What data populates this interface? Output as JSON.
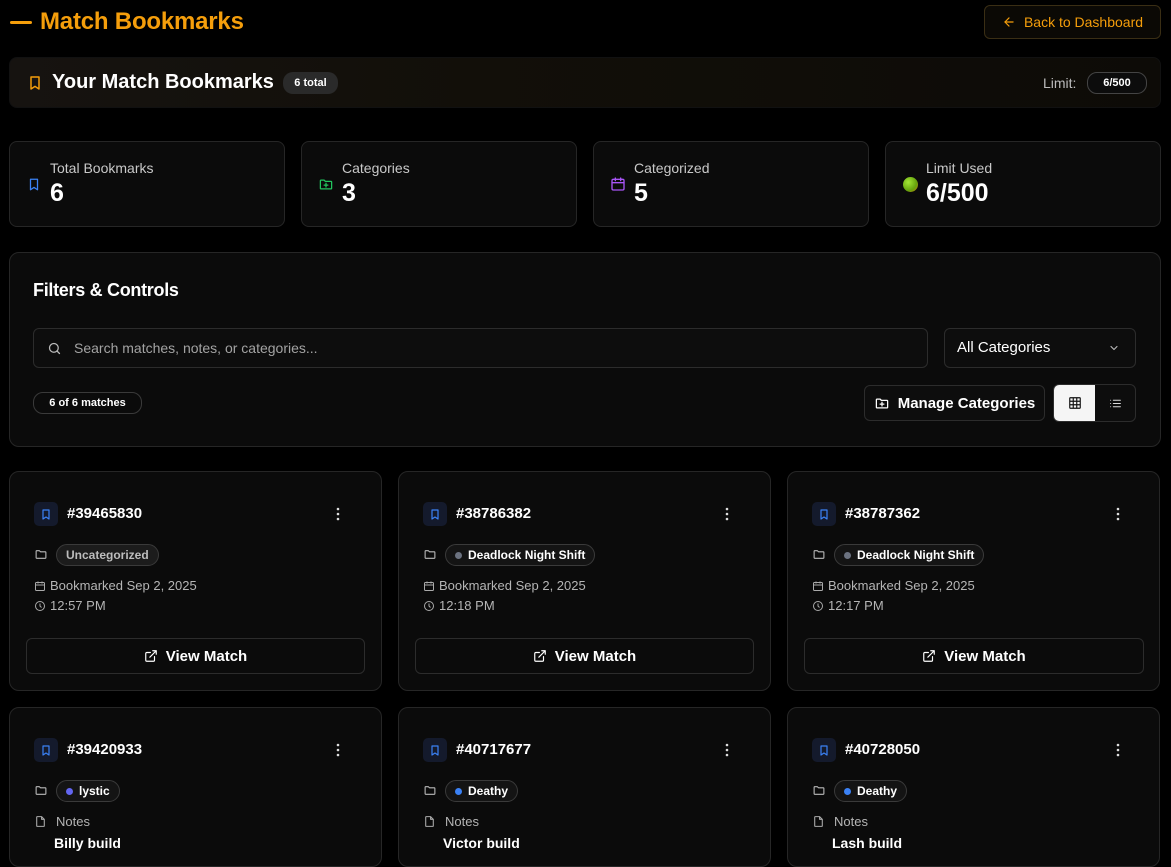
{
  "header": {
    "title": "Match Bookmarks",
    "back_label": "Back to Dashboard"
  },
  "banner": {
    "title": "Your Match Bookmarks",
    "total_badge": "6 total",
    "limit_label": "Limit:",
    "limit_value": "6/500"
  },
  "stats": [
    {
      "label": "Total Bookmarks",
      "value": "6",
      "icon": "bookmark-icon",
      "color": "#3b82f6"
    },
    {
      "label": "Categories",
      "value": "3",
      "icon": "folder-plus-icon",
      "color": "#22c55e"
    },
    {
      "label": "Categorized",
      "value": "5",
      "icon": "calendar-icon",
      "color": "#a855f7"
    },
    {
      "label": "Limit Used",
      "value": "6/500",
      "icon": "usage-indicator-icon",
      "color": "#84cc16"
    }
  ],
  "filters": {
    "title": "Filters & Controls",
    "search_placeholder": "Search matches, notes, or categories...",
    "category_select": "All Categories",
    "match_count": "6 of 6 matches",
    "manage_label": "Manage Categories",
    "view_mode": "grid"
  },
  "cards": [
    {
      "id": "#39465830",
      "category": "Uncategorized",
      "dot": "",
      "bookmarked": "Bookmarked Sep 2, 2025",
      "time": "12:57 PM",
      "view_label": "View Match"
    },
    {
      "id": "#38786382",
      "category": "Deadlock Night Shift",
      "dot": "#6b7280",
      "bookmarked": "Bookmarked Sep 2, 2025",
      "time": "12:18 PM",
      "view_label": "View Match"
    },
    {
      "id": "#38787362",
      "category": "Deadlock Night Shift",
      "dot": "#6b7280",
      "bookmarked": "Bookmarked Sep 2, 2025",
      "time": "12:17 PM",
      "view_label": "View Match"
    },
    {
      "id": "#39420933",
      "category": "lystic",
      "dot": "#6366f1",
      "notes_label": "Notes",
      "notes": "Billy build"
    },
    {
      "id": "#40717677",
      "category": "Deathy",
      "dot": "#3b82f6",
      "notes_label": "Notes",
      "notes": "Victor build"
    },
    {
      "id": "#40728050",
      "category": "Deathy",
      "dot": "#3b82f6",
      "notes_label": "Notes",
      "notes": "Lash build"
    }
  ],
  "colors": {
    "accent": "#f59e0b",
    "background": "#000000",
    "card": "#0b0b0b",
    "border": "#262626"
  }
}
